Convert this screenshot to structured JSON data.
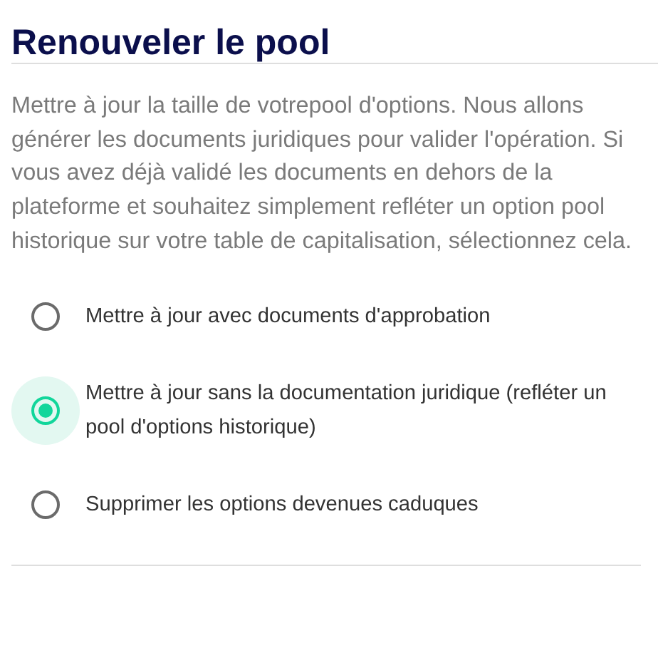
{
  "title": "Renouveler le pool",
  "description": "Mettre à jour la taille de votrepool d'options. Nous allons générer les documents juridiques pour valider l'opération. Si vous avez déjà validé les documents en dehors de la plateforme et souhaitez simplement refléter un option pool historique sur votre table de capitalisation, sélectionnez cela.",
  "options": [
    {
      "label": "Mettre à jour avec documents d'approbation",
      "selected": false
    },
    {
      "label": "Mettre à jour sans la documentation juridique (refléter un pool d'options historique)",
      "selected": true
    },
    {
      "label": "Supprimer les options devenues caduques",
      "selected": false
    }
  ]
}
